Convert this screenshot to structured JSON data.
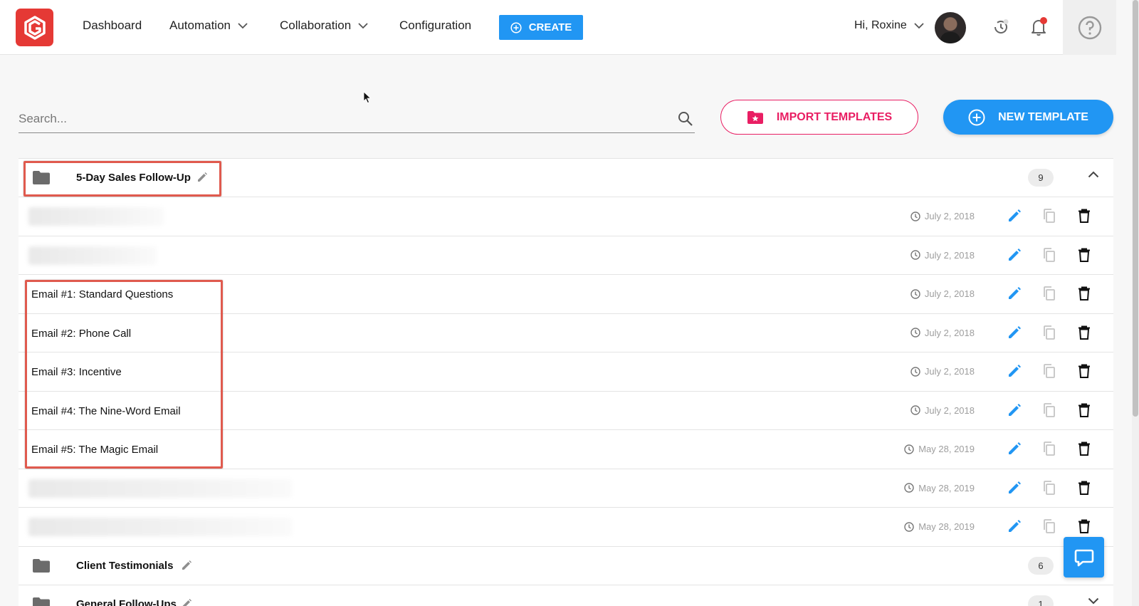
{
  "nav": {
    "items": [
      {
        "label": "Dashboard",
        "has_dropdown": false
      },
      {
        "label": "Automation",
        "has_dropdown": true
      },
      {
        "label": "Collaboration",
        "has_dropdown": true
      },
      {
        "label": "Configuration",
        "has_dropdown": false
      }
    ],
    "create_label": "CREATE",
    "greeting": "Hi, Roxine"
  },
  "search": {
    "placeholder": "Search..."
  },
  "actions": {
    "import_label": "IMPORT TEMPLATES",
    "new_label": "NEW TEMPLATE"
  },
  "folders": [
    {
      "name": "5-Day Sales Follow-Up",
      "count": "9",
      "expanded": true,
      "templates": [
        {
          "name": "",
          "blurred": true,
          "date": "July 2, 2018"
        },
        {
          "name": "",
          "blurred": true,
          "date": "July 2, 2018"
        },
        {
          "name": "Email #1: Standard Questions",
          "blurred": false,
          "date": "July 2, 2018"
        },
        {
          "name": "Email #2: Phone Call",
          "blurred": false,
          "date": "July 2, 2018"
        },
        {
          "name": "Email #3: Incentive",
          "blurred": false,
          "date": "July 2, 2018"
        },
        {
          "name": "Email #4: The Nine-Word Email",
          "blurred": false,
          "date": "July 2, 2018"
        },
        {
          "name": "Email #5: The Magic Email",
          "blurred": false,
          "date": "May 28, 2019"
        },
        {
          "name": "",
          "blurred": true,
          "date": "May 28, 2019"
        },
        {
          "name": "",
          "blurred": true,
          "date": "May 28, 2019"
        }
      ]
    },
    {
      "name": "Client Testimonials",
      "count": "6",
      "expanded": false
    },
    {
      "name": "General Follow-Ups",
      "count": "1",
      "expanded": false
    }
  ],
  "colors": {
    "brand_red": "#e53935",
    "primary_blue": "#2196f3",
    "import_pink": "#e91e63",
    "highlight_red": "#e05a4e"
  },
  "icons": [
    "logo-icon",
    "chevron-down-icon",
    "plus-circle-icon",
    "history-icon",
    "bell-icon",
    "help-icon",
    "search-icon",
    "folder-star-icon",
    "folder-icon",
    "pencil-icon",
    "chevron-up-icon",
    "clock-icon",
    "copy-icon",
    "trash-icon",
    "chat-icon"
  ]
}
